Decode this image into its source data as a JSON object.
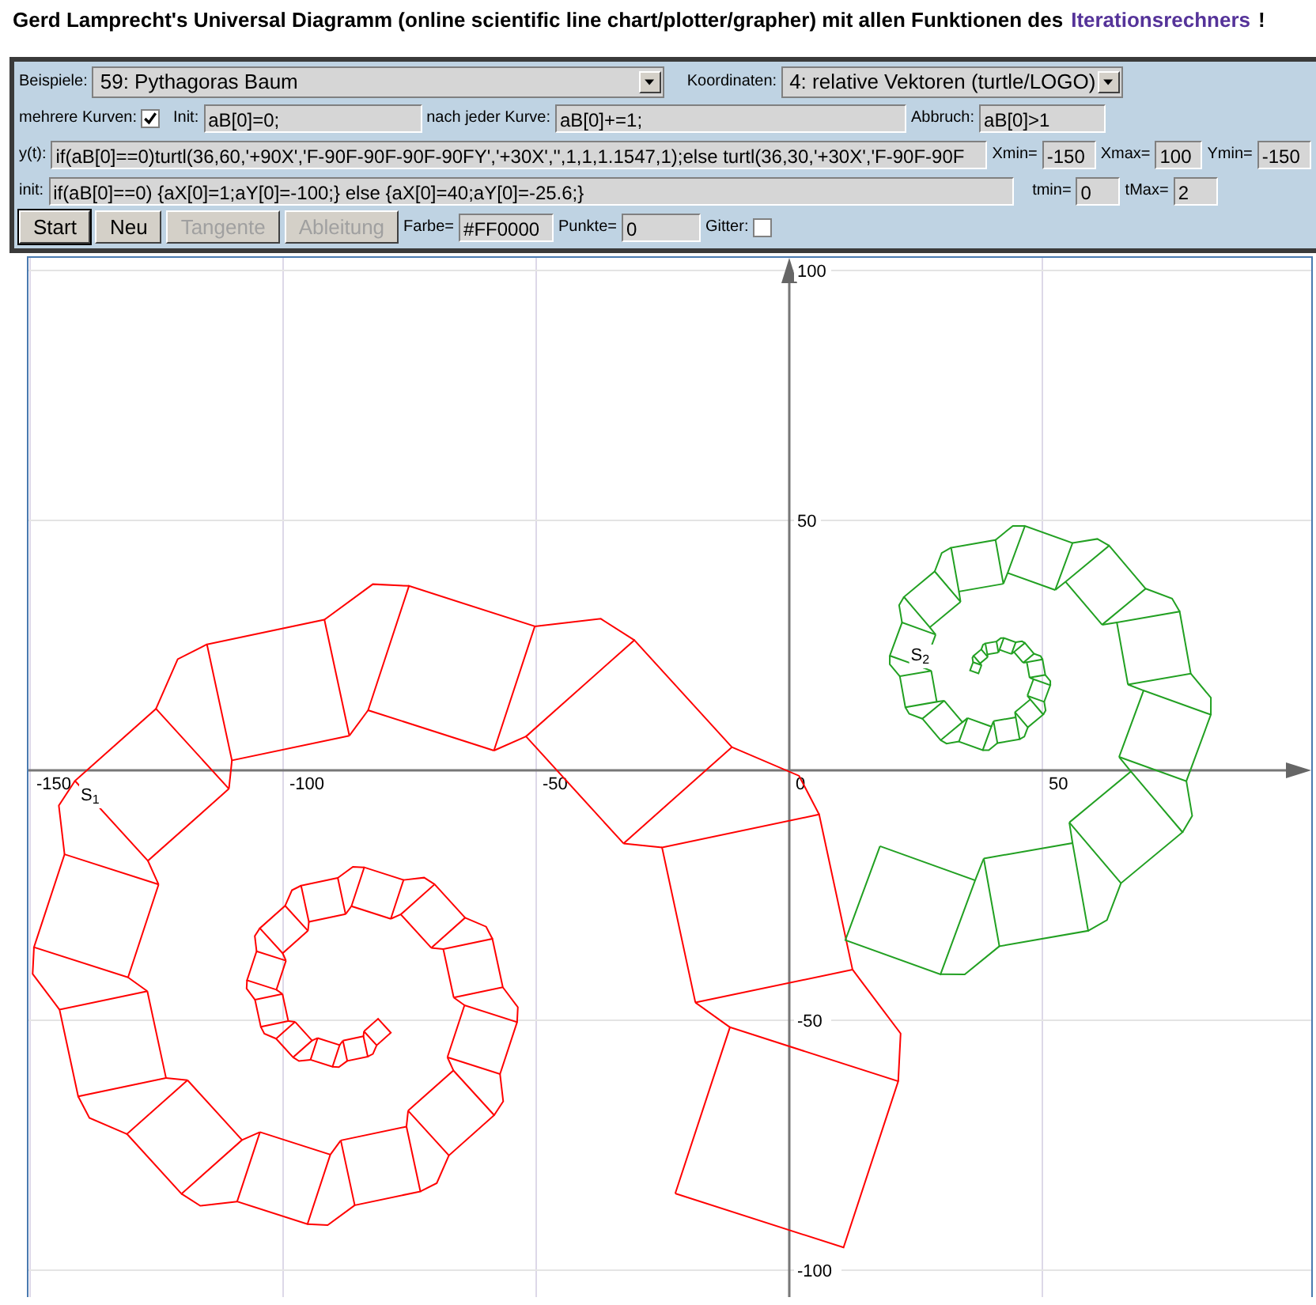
{
  "heading": {
    "text": "Gerd Lamprecht's Universal Diagramm (online scientific line chart/plotter/grapher) mit allen Funktionen des",
    "link": "Iterationsrechners",
    "suffix": "!"
  },
  "form": {
    "examples": {
      "label": "Beispiele:",
      "value": "59: Pythagoras Baum"
    },
    "coordinates": {
      "label": "Koordinaten:",
      "value": "4: relative Vektoren (turtle/LOGO)"
    },
    "multiple_curves": {
      "label": "mehrere Kurven:",
      "checked": true
    },
    "init": {
      "label": "Init:",
      "value": "aB[0]=0;"
    },
    "after_each_curve": {
      "label": "nach jeder Kurve:",
      "value": "aB[0]+=1;"
    },
    "stop": {
      "label": "Abbruch:",
      "value": "aB[0]>1"
    },
    "y_t": {
      "label": "y(t):",
      "value": "if(aB[0]==0)turtl(36,60,'+90X','F-90F-90F-90F-90FY','+30X','',1,1,1.1547,1);else turtl(36,30,'+30X','F-90F-90F"
    },
    "xmin": {
      "label": "Xmin=",
      "value": "-150"
    },
    "xmax": {
      "label": "Xmax=",
      "value": "100"
    },
    "ymin": {
      "label": "Ymin=",
      "value": "-150"
    },
    "init2": {
      "label": "init:",
      "value": "if(aB[0]==0) {aX[0]=1;aY[0]=-100;} else {aX[0]=40;aY[0]=-25.6;}"
    },
    "tmin": {
      "label": "tmin=",
      "value": "0"
    },
    "tmax": {
      "label": "tMax=",
      "value": "2"
    },
    "buttons": [
      {
        "label": "Start",
        "disabled": false,
        "selected": true
      },
      {
        "label": "Neu",
        "disabled": false,
        "selected": false
      },
      {
        "label": "Tangente",
        "disabled": true,
        "selected": false
      },
      {
        "label": "Ableitung",
        "disabled": true,
        "selected": false
      }
    ],
    "color": {
      "label": "Farbe=",
      "value": "#FF0000"
    },
    "points": {
      "label": "Punkte=",
      "value": "0"
    },
    "grid": {
      "label": "Gitter:",
      "checked": false
    }
  },
  "plot": {
    "x_tick_labels": [
      "-150",
      "-100",
      "-50",
      "0",
      "50"
    ],
    "y_tick_labels": [
      "100",
      "50",
      "-50",
      "-100"
    ],
    "curves": [
      {
        "label": "S",
        "index": "1",
        "color": "#ff0000"
      },
      {
        "label": "S",
        "index": "2",
        "color": "#22a022"
      }
    ]
  }
}
